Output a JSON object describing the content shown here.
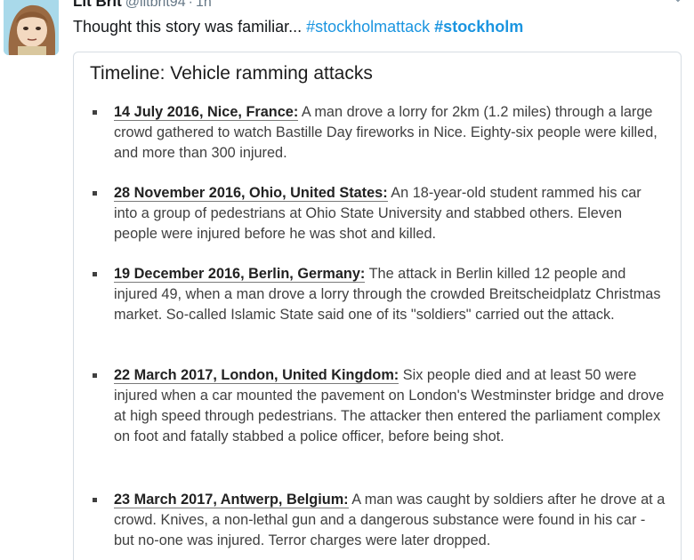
{
  "tweet": {
    "display_name": "Lit Brit",
    "handle": "@litbrit94",
    "separator": "·",
    "time": "1h",
    "text": "Thought this story was familiar...",
    "hashtags": [
      "#stockholmattack",
      "#stockholm"
    ]
  },
  "card": {
    "title": "Timeline: Vehicle ramming attacks",
    "entries": [
      {
        "heading": "14 July 2016, Nice, France:",
        "body": "A man drove a lorry for 2km (1.2 miles) through a large crowd gathered to watch Bastille Day fireworks in Nice. Eighty-six people were killed, and more than 300 injured."
      },
      {
        "heading": "28 November 2016, Ohio, United States:",
        "body": "An 18-year-old student rammed his car into a group of pedestrians at Ohio State University and stabbed others. Eleven people were injured before he was shot and killed."
      },
      {
        "heading": "19 December 2016, Berlin, Germany:",
        "body": "The attack in Berlin killed 12 people and injured 49, when a man drove a lorry through the crowded Breitscheidplatz Christmas market. So-called Islamic State said one of its \"soldiers\" carried out the attack."
      },
      {
        "heading": "22 March 2017, London, United Kingdom:",
        "body": "Six people died and at least 50 were injured when a car mounted the pavement on London's Westminster bridge and drove at high speed through pedestrians. The attacker then entered the parliament complex on foot and fatally stabbed a police officer, before being shot."
      },
      {
        "heading": "23 March 2017, Antwerp, Belgium:",
        "body": "A man was caught by soldiers after he drove at a crowd. Knives, a non-lethal gun and a dangerous substance were found in his car - but no-one was injured. Terror charges were later dropped."
      }
    ]
  },
  "icons": {
    "avatar": "avatar-illustration",
    "menu": "chevron-down-icon"
  },
  "colors": {
    "hashtag": "#1b95e0",
    "muted": "#657786",
    "card_border": "#d6dde3"
  }
}
